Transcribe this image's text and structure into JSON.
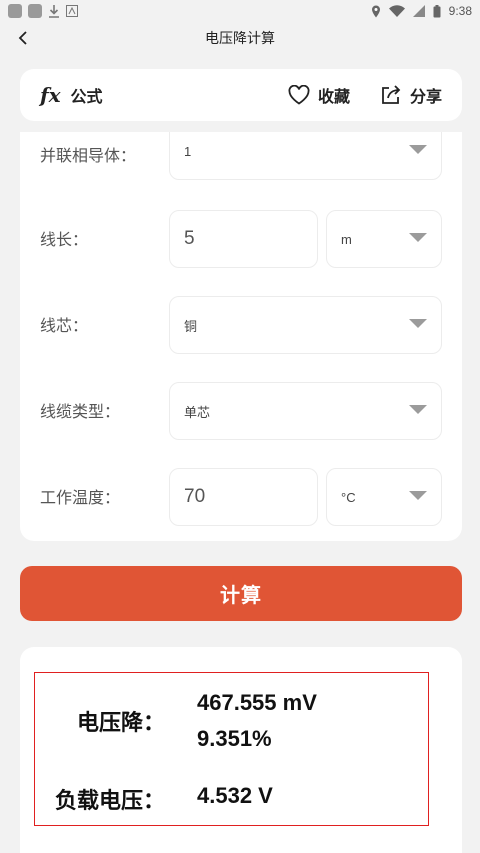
{
  "status_bar": {
    "time": "9:38"
  },
  "header": {
    "title": "电压降计算"
  },
  "formula_bar": {
    "fx": "fx",
    "label": "公式",
    "favorite": "收藏",
    "share": "分享"
  },
  "form": {
    "parallel_conductors": {
      "label": "并联相导体：",
      "value": "1"
    },
    "length": {
      "label": "线长：",
      "value": "5",
      "unit": "m"
    },
    "core": {
      "label": "线芯：",
      "value": "铜"
    },
    "cable_type": {
      "label": "线缆类型：",
      "value": "单芯"
    },
    "temperature": {
      "label": "工作温度：",
      "value": "70",
      "unit": "°C"
    }
  },
  "calculate_button": "计算",
  "result": {
    "voltage_drop_label": "电压降：",
    "voltage_drop_value": "467.555 mV",
    "voltage_drop_percent": "9.351%",
    "load_voltage_label": "负载电压：",
    "load_voltage_value": "4.532 V"
  },
  "colors": {
    "accent": "#e05535",
    "highlight_border": "#e02020",
    "background": "#f2f2f2"
  }
}
